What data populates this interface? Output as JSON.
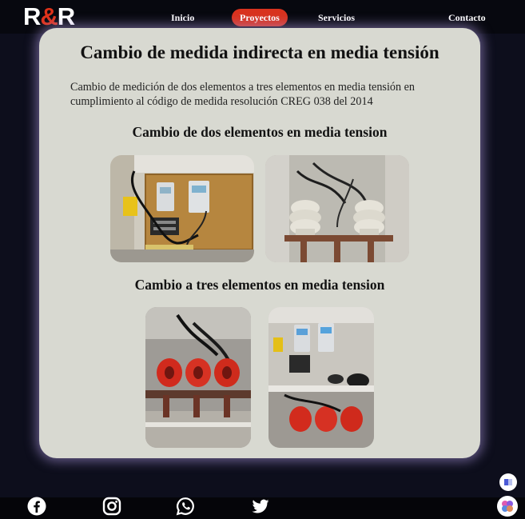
{
  "brand": {
    "logo_left": "R",
    "logo_amp": "&",
    "logo_right": "R"
  },
  "nav": {
    "inicio": "Inicio",
    "proyectos": "Proyectos",
    "servicios": "Servicios",
    "contacto": "Contacto"
  },
  "main": {
    "title": "Cambio de medida indirecta en media tensión",
    "description": "Cambio de medición de dos elementos a tres elementos en media tensión en cumplimiento al código de medida resolución CREG 038 del 2014",
    "sections": [
      {
        "title": "Cambio de dos elementos en media tension"
      },
      {
        "title": "Cambio a tres elementos en media tension"
      }
    ]
  },
  "footer": {
    "icons": [
      "facebook-icon",
      "instagram-icon",
      "whatsapp-icon",
      "twitter-icon"
    ]
  },
  "colors": {
    "accent": "#d8321e",
    "background": "#0d0e1c",
    "card": "#d8d9d1"
  }
}
